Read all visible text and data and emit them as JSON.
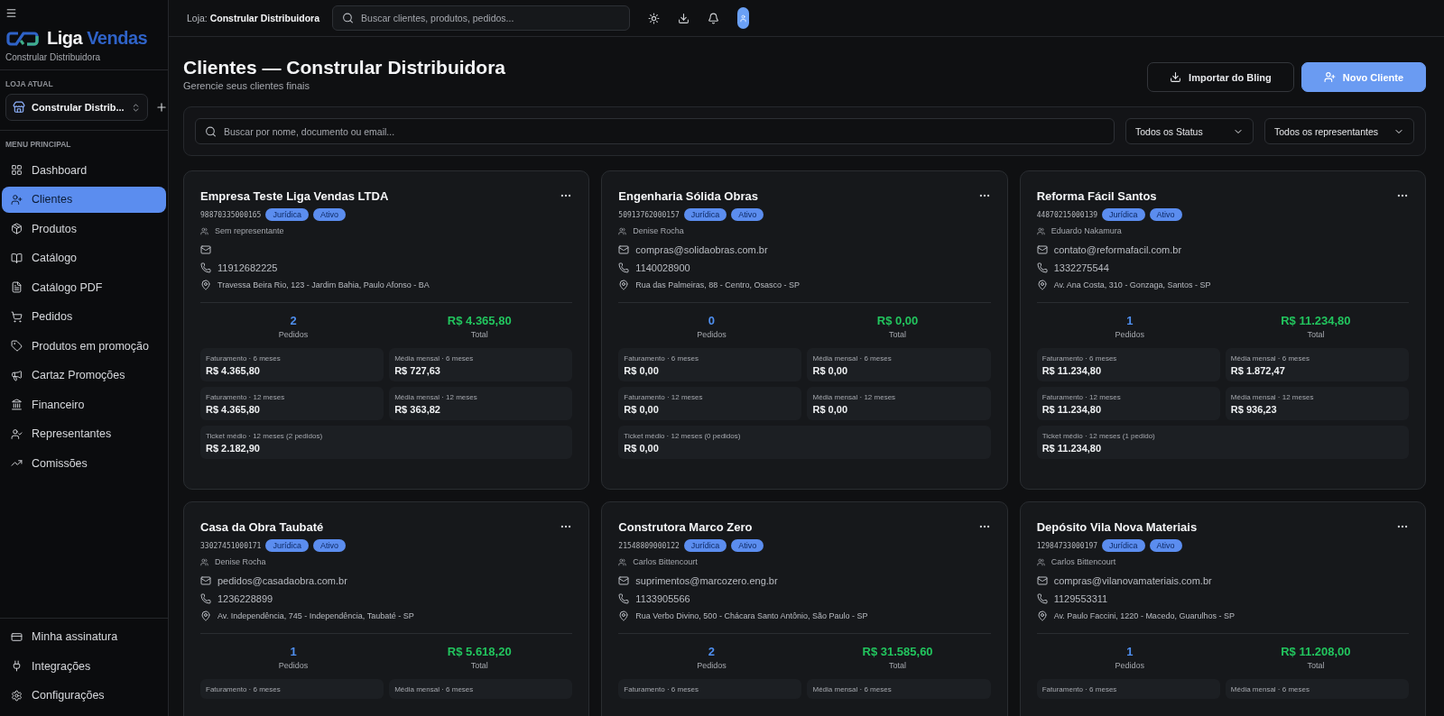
{
  "sidebar": {
    "logo": {
      "parts": [
        "Liga",
        "Vendas"
      ],
      "subtitle": "Constrular Distribuidora"
    },
    "store_section": {
      "label": "LOJA ATUAL",
      "current_store": "Constrular Distrib..."
    },
    "menu_label": "MENU PRINCIPAL",
    "items": [
      {
        "kind": "dashboard",
        "label": "Dashboard",
        "selected": false
      },
      {
        "kind": "clients",
        "label": "Clientes",
        "selected": true
      },
      {
        "kind": "products",
        "label": "Produtos",
        "selected": false
      },
      {
        "kind": "catalog",
        "label": "Catálogo",
        "selected": false
      },
      {
        "kind": "pdf",
        "label": "Catálogo PDF",
        "selected": false
      },
      {
        "kind": "orders",
        "label": "Pedidos",
        "selected": false
      },
      {
        "kind": "promo",
        "label": "Produtos em promoção",
        "selected": false
      },
      {
        "kind": "poster",
        "label": "Cartaz Promoções",
        "selected": false
      },
      {
        "kind": "finance",
        "label": "Financeiro",
        "selected": false
      },
      {
        "kind": "reps",
        "label": "Representantes",
        "selected": false
      },
      {
        "kind": "commissions",
        "label": "Comissões",
        "selected": false
      }
    ],
    "footer_items": [
      {
        "kind": "subscription",
        "label": "Minha assinatura",
        "selected": false
      },
      {
        "kind": "integrations",
        "label": "Integrações",
        "selected": false
      },
      {
        "kind": "settings",
        "label": "Configurações",
        "selected": false
      }
    ]
  },
  "topbar": {
    "store": "Loja: **Constrular Distribuidora**",
    "search": {
      "placeholder": "Buscar clientes, produtos, pedidos..."
    }
  },
  "page": {
    "title": "Clientes — Constrular Distribuidora",
    "subtitle": "Gerencie seus clientes finais",
    "buttons": [
      {
        "kind": "import",
        "label": "Importar do Bling"
      },
      {
        "kind": "new",
        "label": "Novo Cliente"
      }
    ]
  },
  "filters": {
    "search": {
      "placeholder": "Buscar por nome, documento ou email..."
    },
    "status": "Todos os Status",
    "representative": "Todos os representantes"
  },
  "clients": [
    {
      "name": "Empresa Teste Liga Vendas LTDA",
      "document": "98870335000165",
      "badges": [
        "Jurídica",
        "Ativo"
      ],
      "representative": "Sem representante",
      "phone": "11912682225",
      "address": "Travessa Beira Rio, 123 - Jardim Bahia, Paulo Afonso - BA",
      "orders": "2",
      "orders_label": "Pedidos",
      "total": "R$ 4.365,80",
      "total_label": "Total",
      "metrics": [
        {
          "label": "Faturamento · 6 meses",
          "value": "R$ 4.365,80"
        },
        {
          "label": "Média mensal · 6 meses",
          "value": "R$ 727,63"
        },
        {
          "label": "Faturamento · 12 meses",
          "value": "R$ 4.365,80"
        },
        {
          "label": "Média mensal · 12 meses",
          "value": "R$ 363,82"
        },
        {
          "label": "Ticket médio · 12 meses (2 pedidos)",
          "value": "R$ 2.182,90"
        }
      ]
    },
    {
      "name": "Engenharia Sólida Obras",
      "document": "50913762000157",
      "badges": [
        "Jurídica",
        "Ativo"
      ],
      "representative": "Denise Rocha",
      "email": "compras@solidaobras.com.br",
      "phone": "1140028900",
      "address": "Rua das Palmeiras, 88 - Centro, Osasco - SP",
      "orders": "0",
      "orders_label": "Pedidos",
      "total": "R$ 0,00",
      "total_label": "Total",
      "metrics": [
        {
          "label": "Faturamento · 6 meses",
          "value": "R$ 0,00"
        },
        {
          "label": "Média mensal · 6 meses",
          "value": "R$ 0,00"
        },
        {
          "label": "Faturamento · 12 meses",
          "value": "R$ 0,00"
        },
        {
          "label": "Média mensal · 12 meses",
          "value": "R$ 0,00"
        },
        {
          "label": "Ticket médio · 12 meses (0 pedidos)",
          "value": "R$ 0,00"
        }
      ]
    },
    {
      "name": "Reforma Fácil Santos",
      "document": "44870215000139",
      "badges": [
        "Jurídica",
        "Ativo"
      ],
      "representative": "Eduardo Nakamura",
      "email": "contato@reformafacil.com.br",
      "phone": "1332275544",
      "address": "Av. Ana Costa, 310 - Gonzaga, Santos - SP",
      "orders": "1",
      "orders_label": "Pedidos",
      "total": "R$ 11.234,80",
      "total_label": "Total",
      "metrics": [
        {
          "label": "Faturamento · 6 meses",
          "value": "R$ 11.234,80"
        },
        {
          "label": "Média mensal · 6 meses",
          "value": "R$ 1.872,47"
        },
        {
          "label": "Faturamento · 12 meses",
          "value": "R$ 11.234,80"
        },
        {
          "label": "Média mensal · 12 meses",
          "value": "R$ 936,23"
        },
        {
          "label": "Ticket médio · 12 meses (1 pedido)",
          "value": "R$ 11.234,80"
        }
      ]
    },
    {
      "name": "Casa da Obra Taubaté",
      "document": "33027451000171",
      "badges": [
        "Jurídica",
        "Ativo"
      ],
      "representative": "Denise Rocha",
      "email": "pedidos@casadaobra.com.br",
      "phone": "1236228899",
      "address": "Av. Independência, 745 - Independência, Taubaté - SP",
      "orders": "1",
      "orders_label": "Pedidos",
      "total": "R$ 5.618,20",
      "total_label": "Total",
      "metrics": [
        {
          "label": "Faturamento · 6 meses"
        },
        {
          "label": "Média mensal · 6 meses"
        }
      ]
    },
    {
      "name": "Construtora Marco Zero",
      "document": "21548809000122",
      "badges": [
        "Jurídica",
        "Ativo"
      ],
      "representative": "Carlos Bittencourt",
      "email": "suprimentos@marcozero.eng.br",
      "phone": "1133905566",
      "address": "Rua Verbo Divino, 500 - Chácara Santo Antônio, São Paulo - SP",
      "orders": "2",
      "orders_label": "Pedidos",
      "total": "R$ 31.585,60",
      "total_label": "Total",
      "metrics": [
        {
          "label": "Faturamento · 6 meses"
        },
        {
          "label": "Média mensal · 6 meses"
        }
      ]
    },
    {
      "name": "Depósito Vila Nova Materiais",
      "document": "12984733000197",
      "badges": [
        "Jurídica",
        "Ativo"
      ],
      "representative": "Carlos Bittencourt",
      "email": "compras@vilanovamateriais.com.br",
      "phone": "1129553311",
      "address": "Av. Paulo Faccini, 1220 - Macedo, Guarulhos - SP",
      "orders": "1",
      "orders_label": "Pedidos",
      "total": "R$ 11.208,00",
      "total_label": "Total",
      "metrics": [
        {
          "label": "Faturamento · 6 meses"
        },
        {
          "label": "Média mensal · 6 meses"
        }
      ]
    }
  ]
}
